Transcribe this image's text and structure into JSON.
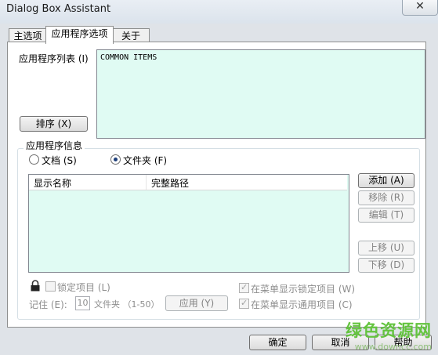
{
  "window": {
    "title": "Dialog Box Assistant",
    "close_label": "✕"
  },
  "tabs": [
    {
      "label": "主选项"
    },
    {
      "label": "应用程序选项"
    },
    {
      "label": "关于"
    }
  ],
  "app_list": {
    "label": "应用程序列表 (I)",
    "items": [
      "COMMON ITEMS"
    ],
    "sort_button": "排序 (X)"
  },
  "app_info": {
    "group_title": "应用程序信息",
    "radio_document": "文档 (S)",
    "radio_folder": "文件夹 (F)",
    "selected": "文件夹 (F)",
    "columns": [
      "显示名称",
      "完整路径"
    ],
    "buttons": {
      "add": "添加 (A)",
      "remove": "移除 (R)",
      "edit": "编辑 (T)",
      "move_up": "上移 (U)",
      "move_down": "下移 (D)"
    },
    "lock_item": "锁定项目 (L)",
    "remember_label": "记住 (E):",
    "remember_value": "10",
    "remember_suffix": "文件夹 （1-50）",
    "apply_button": "应用 (Y)",
    "show_locked": "在菜单显示锁定项目 (W)",
    "show_common": "在菜单显示通用项目 (C)"
  },
  "footer": {
    "ok": "确定",
    "cancel": "取消",
    "help": "帮助"
  },
  "watermark": {
    "line1": "绿色资源网",
    "line2": "www.downcc.com"
  }
}
